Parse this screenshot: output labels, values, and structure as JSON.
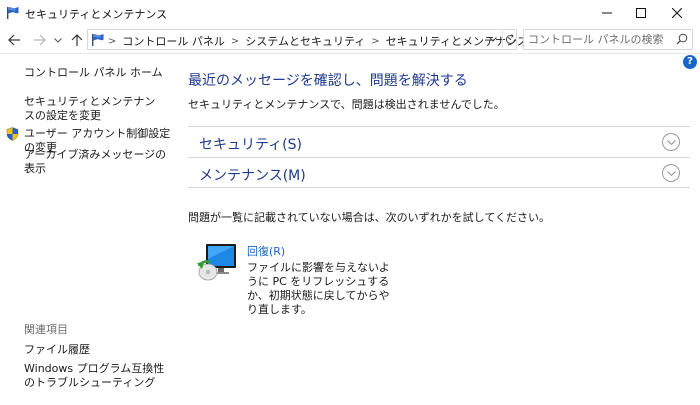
{
  "window": {
    "title": "セキュリティとメンテナンス"
  },
  "address_bar": {
    "breadcrumbs": [
      "コントロール パネル",
      "システムとセキュリティ",
      "セキュリティとメンテナンス"
    ]
  },
  "search": {
    "placeholder": "コントロール パネルの検索"
  },
  "help": {
    "label": "?"
  },
  "sidebar": {
    "home": "コントロール パネル ホーム",
    "settings": "セキュリティとメンテナンスの設定を変更",
    "uac": "ユーザー アカウント制御設定の変更",
    "archive": "アーカイブ済みメッセージの表示",
    "related_label": "関連項目",
    "file_history": "ファイル履歴",
    "compat": "Windows プログラム互換性のトラブルシューティング"
  },
  "main": {
    "title": "最近のメッセージを確認し、問題を解決する",
    "subtitle": "セキュリティとメンテナンスで、問題は検出されませんでした。",
    "sections": {
      "security": "セキュリティ(S)",
      "maintenance": "メンテナンス(M)"
    },
    "note": "問題が一覧に記載されていない場合は、次のいずれかを試してください。",
    "recovery": {
      "link": "回復(R)",
      "description": "ファイルに影響を与えないように PC をリフレッシュするか、初期状態に戻してからやり直します。"
    }
  },
  "colors": {
    "heading_blue": "#1e3a8c",
    "link_blue": "#1565c0",
    "help_blue": "#1568c9"
  }
}
